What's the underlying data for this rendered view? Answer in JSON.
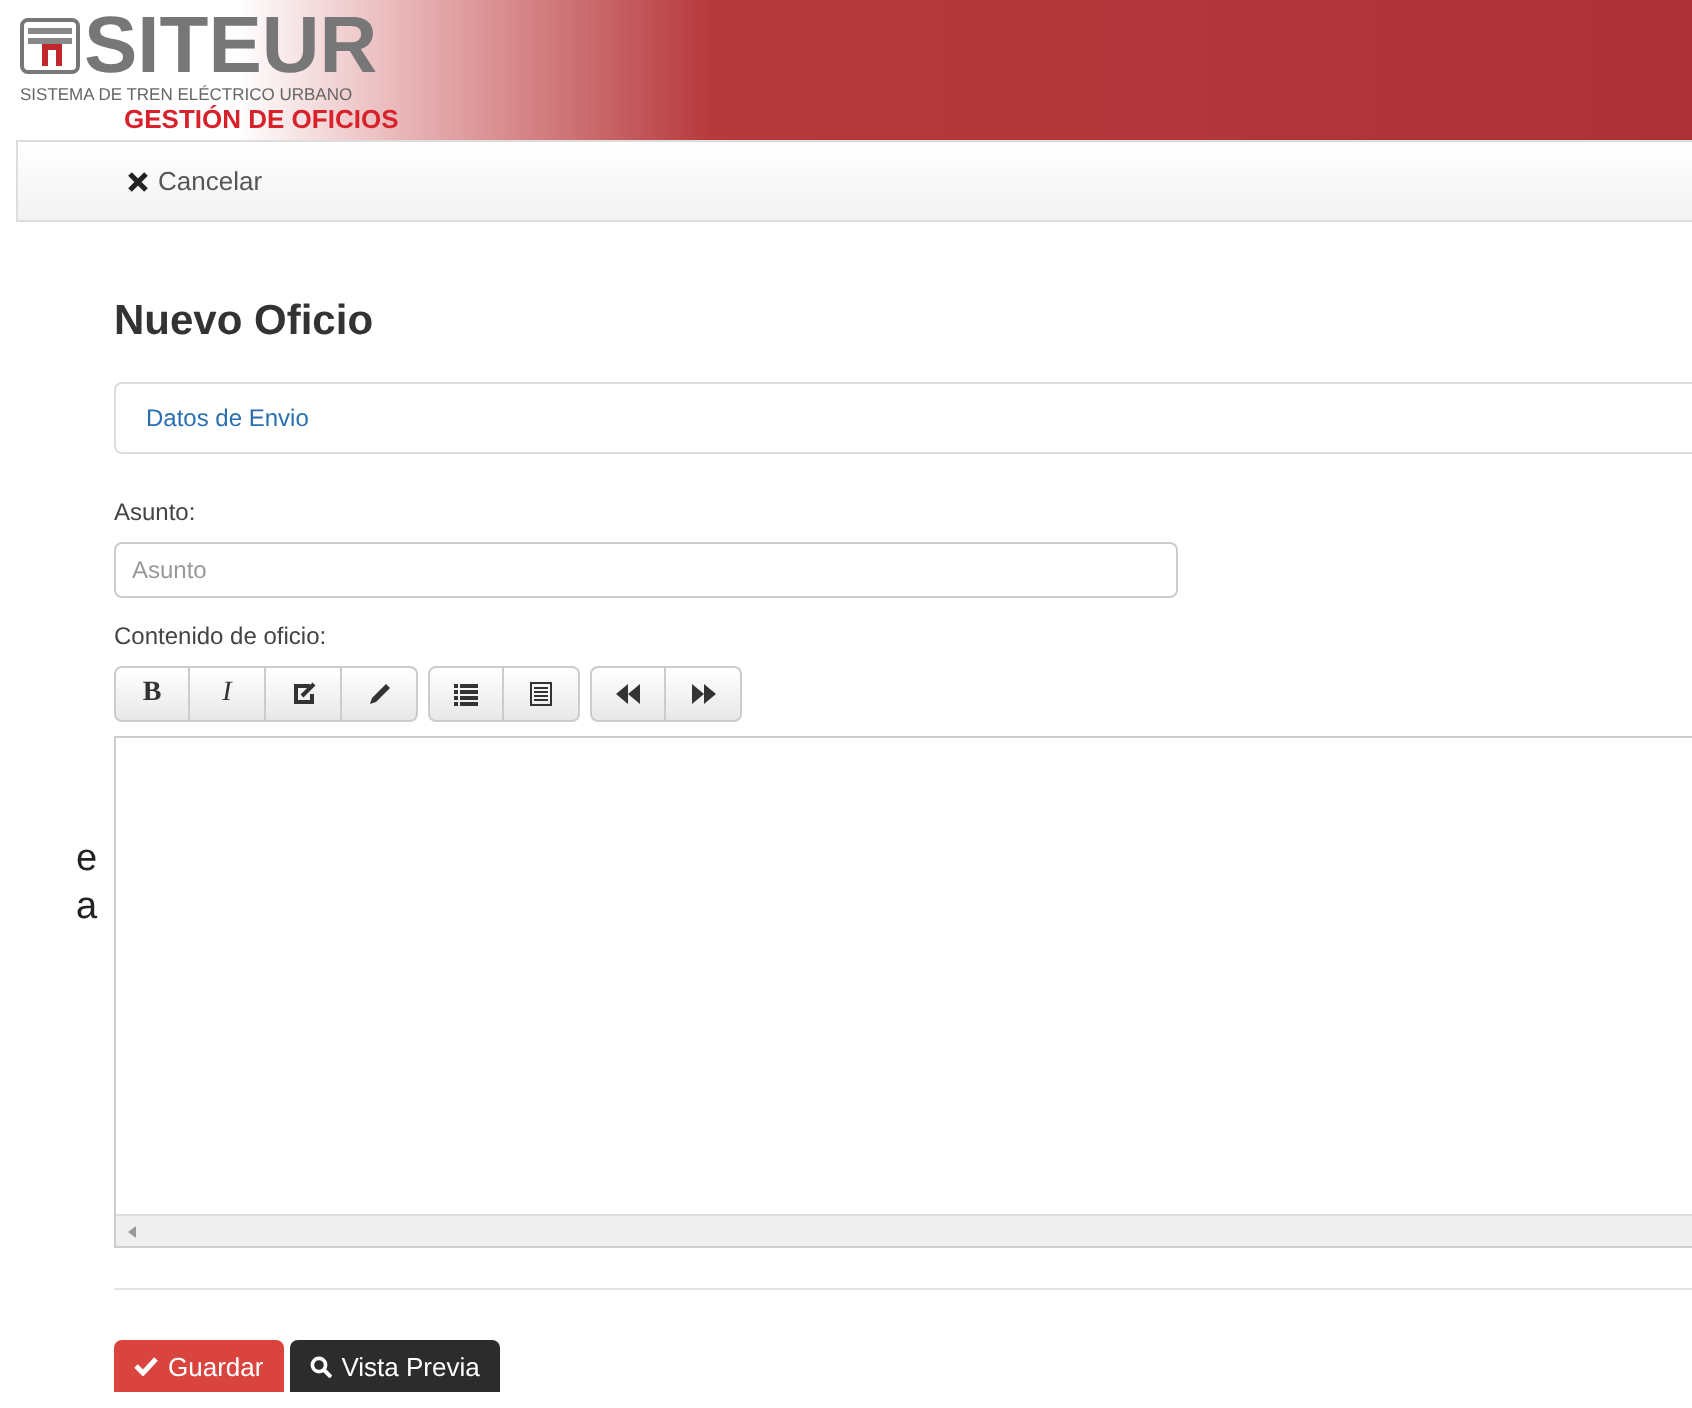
{
  "header": {
    "logo_title": "SITEUR",
    "logo_subtitle": "SISTEMA DE TREN ELÉCTRICO URBANO",
    "app_name": "GESTIÓN DE OFICIOS"
  },
  "navbar": {
    "cancel": "Cancelar"
  },
  "side_text": [
    "e",
    "a"
  ],
  "page_title": "Nuevo Oficio",
  "panel": {
    "title": "Datos de Envio"
  },
  "subject": {
    "label": "Asunto:",
    "placeholder": "Asunto"
  },
  "content": {
    "label": "Contenido de oficio:",
    "bold": "B",
    "italic": "I"
  },
  "buttons": {
    "save": "Guardar",
    "preview": "Vista Previa"
  }
}
